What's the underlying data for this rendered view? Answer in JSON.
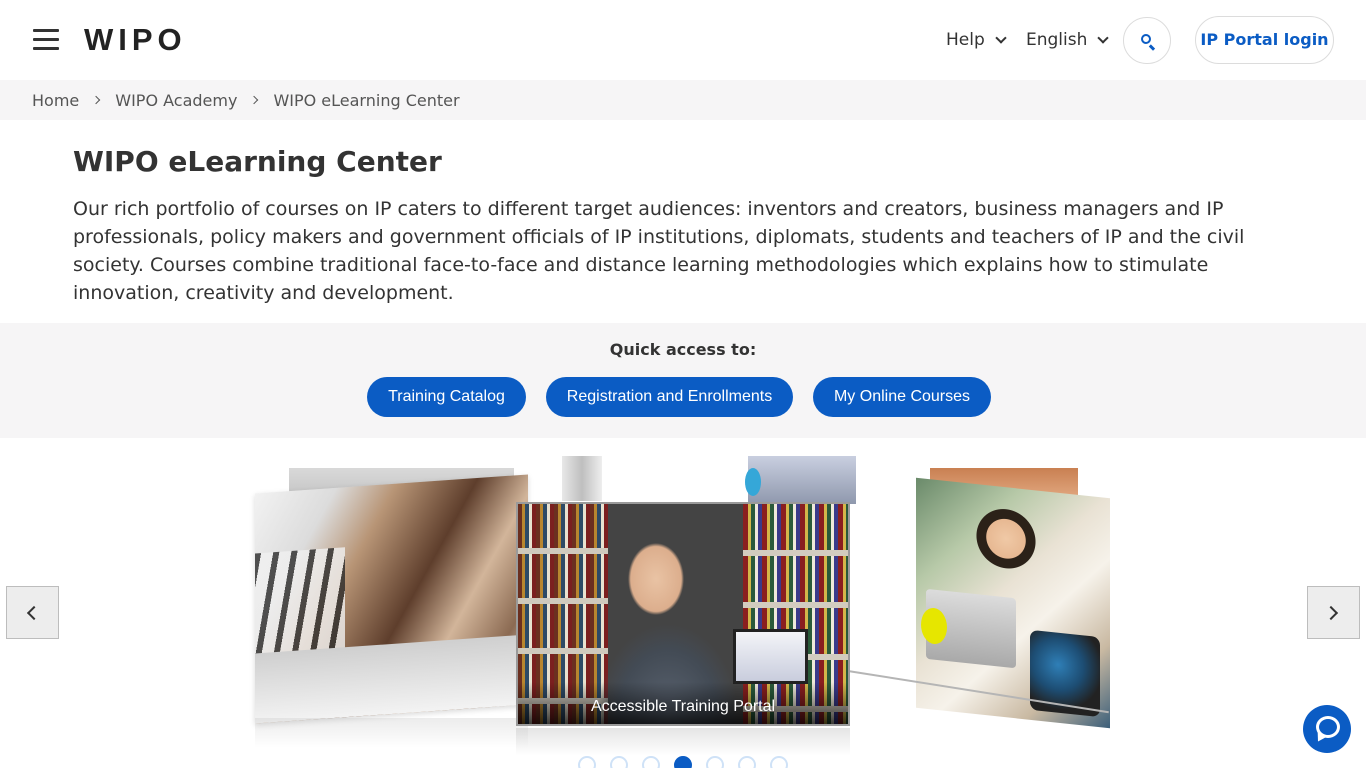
{
  "header": {
    "logo": "WIPO",
    "nav": {
      "help_label": "Help",
      "language_label": "English"
    },
    "login_label": "IP Portal login"
  },
  "breadcrumb": {
    "items": [
      "Home",
      "WIPO Academy",
      "WIPO eLearning Center"
    ]
  },
  "main": {
    "title": "WIPO eLearning Center",
    "intro": "Our rich portfolio of courses on IP caters to different target audiences: inventors and creators, business managers and IP professionals, policy makers and government officials of IP institutions, diplomats, students and teachers of IP and the civil society. Courses combine traditional face-to-face and distance learning methodologies which explains how to stimulate innovation, creativity and development."
  },
  "quick_access": {
    "label": "Quick access to:",
    "buttons": [
      "Training Catalog",
      "Registration and Enrollments",
      "My Online Courses"
    ]
  },
  "carousel": {
    "active_caption": "Accessible Training Portal",
    "dot_count": 7,
    "active_index": 3
  },
  "colors": {
    "brand_blue": "#0b5cc4",
    "breadcrumb_bg": "#f6f5f6"
  },
  "icons": {
    "menu": "hamburger-icon",
    "search": "search-icon",
    "chat": "chat-icon",
    "prev": "chevron-left-icon",
    "next": "chevron-right-icon"
  }
}
